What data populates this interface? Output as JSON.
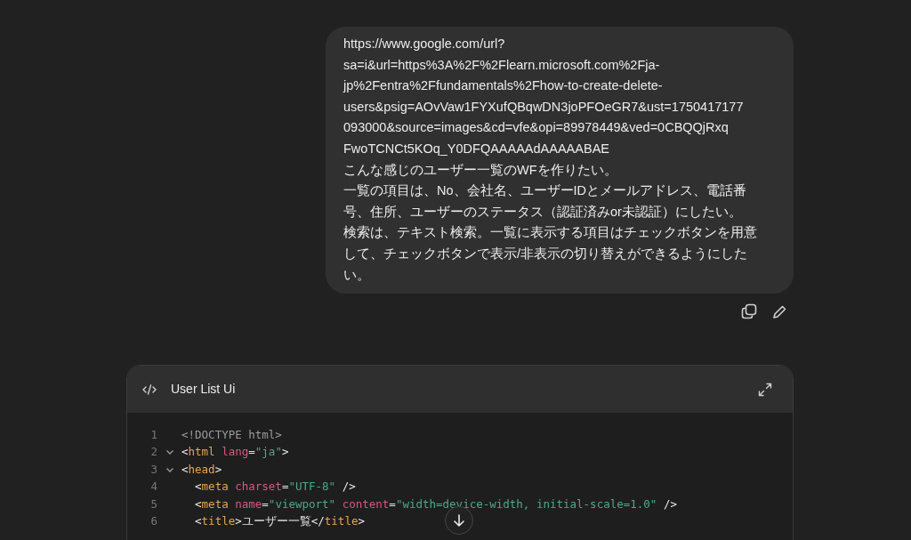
{
  "message": {
    "lines": [
      "https://www.google.com/url?",
      "sa=i&url=https%3A%2F%2Flearn.microsoft.com%2Fja-",
      "jp%2Fentra%2Ffundamentals%2Fhow-to-create-delete-",
      "users&psig=AOvVaw1FYXufQBqwDN3joPFOeGR7&ust=1750417177",
      "093000&source=images&cd=vfe&opi=89978449&ved=0CBQQjRxq",
      "FwoTCNCt5KOq_Y0DFQAAAAAdAAAAABAE",
      "こんな感じのユーザー一覧のWFを作りたい。",
      "一覧の項目は、No、会社名、ユーザーIDとメールアドレス、電話番",
      "号、住所、ユーザーのステータス（認証済みor未認証）にしたい。",
      "検索は、テキスト検索。一覧に表示する項目はチェックボタンを用意",
      "して、チェックボタンで表示/非表示の切り替えができるようにした",
      "い。"
    ]
  },
  "code_panel": {
    "title": "User List Ui",
    "lines": [
      {
        "number": "1",
        "tokens": [
          {
            "kind": "doctype",
            "text": "<!DOCTYPE html>"
          }
        ]
      },
      {
        "number": "2",
        "expanded": true,
        "tokens": [
          {
            "kind": "punct",
            "text": "<"
          },
          {
            "kind": "tag",
            "text": "html"
          },
          {
            "kind": "attr",
            "text": " lang"
          },
          {
            "kind": "punct",
            "text": "="
          },
          {
            "kind": "string",
            "text": "\"ja\""
          },
          {
            "kind": "punct",
            "text": ">"
          }
        ]
      },
      {
        "number": "3",
        "expanded": true,
        "tokens": [
          {
            "kind": "punct",
            "text": "<"
          },
          {
            "kind": "tag",
            "text": "head"
          },
          {
            "kind": "punct",
            "text": ">"
          }
        ]
      },
      {
        "number": "4",
        "tokens": [
          {
            "kind": "punct",
            "text": "  <"
          },
          {
            "kind": "tag",
            "text": "meta"
          },
          {
            "kind": "attr",
            "text": " charset"
          },
          {
            "kind": "punct",
            "text": "="
          },
          {
            "kind": "string",
            "text": "\"UTF-8\""
          },
          {
            "kind": "punct",
            "text": " />"
          }
        ]
      },
      {
        "number": "5",
        "tokens": [
          {
            "kind": "punct",
            "text": "  <"
          },
          {
            "kind": "tag",
            "text": "meta"
          },
          {
            "kind": "attr",
            "text": " name"
          },
          {
            "kind": "punct",
            "text": "="
          },
          {
            "kind": "string",
            "text": "\"viewport\""
          },
          {
            "kind": "attr",
            "text": " content"
          },
          {
            "kind": "punct",
            "text": "="
          },
          {
            "kind": "string",
            "text": "\"width=device-width, initial-scale=1.0\""
          },
          {
            "kind": "punct",
            "text": " />"
          }
        ]
      },
      {
        "number": "6",
        "tokens": [
          {
            "kind": "punct",
            "text": "  <"
          },
          {
            "kind": "tag",
            "text": "title"
          },
          {
            "kind": "punct",
            "text": ">"
          },
          {
            "kind": "text",
            "text": "ユーザー一覧"
          },
          {
            "kind": "punct",
            "text": "</"
          },
          {
            "kind": "tag",
            "text": "title"
          },
          {
            "kind": "punct",
            "text": ">"
          }
        ]
      }
    ]
  }
}
